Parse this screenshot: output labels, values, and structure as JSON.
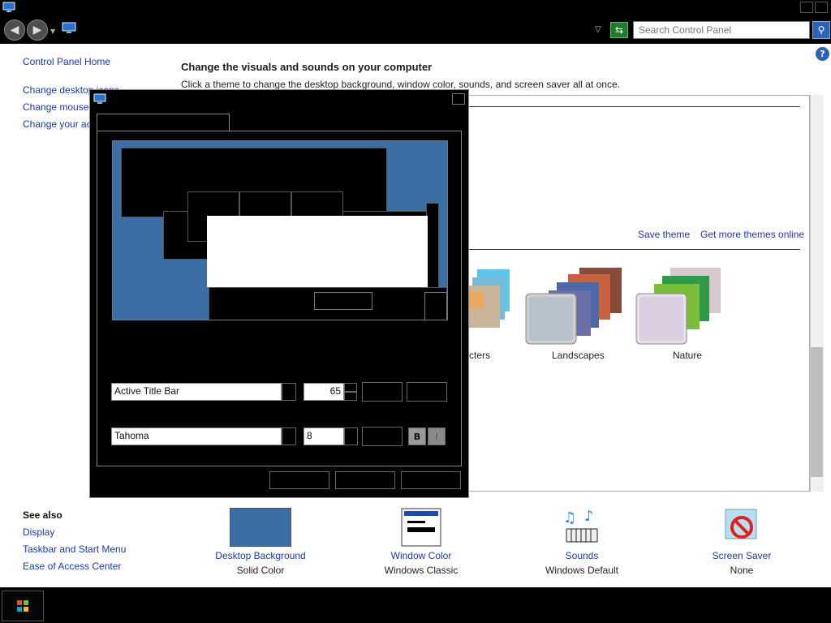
{
  "search": {
    "placeholder": "Search Control Panel"
  },
  "sidebar": {
    "home": "Control Panel Home",
    "links": [
      "Change desktop icons",
      "Change mouse pointers",
      "Change your account picture"
    ],
    "see_also_title": "See also",
    "see_also": [
      "Display",
      "Taskbar and Start Menu",
      "Ease of Access Center"
    ]
  },
  "main": {
    "heading": "Change the visuals and sounds on your computer",
    "subheading": "Click a theme to change the desktop background, window color, sounds, and screen saver all at once.",
    "save_theme": "Save theme",
    "get_more": "Get more themes online",
    "themes": [
      {
        "label": "Characters",
        "visible_label": "cters"
      },
      {
        "label": "Landscapes"
      },
      {
        "label": "Nature"
      }
    ]
  },
  "bottom": [
    {
      "label": "Desktop Background",
      "sub": "Solid Color",
      "icon": "desktop-background-icon"
    },
    {
      "label": "Window Color",
      "sub": "Windows Classic",
      "icon": "window-color-icon"
    },
    {
      "label": "Sounds",
      "sub": "Windows Default",
      "icon": "sounds-icon"
    },
    {
      "label": "Screen Saver",
      "sub": "None",
      "icon": "screen-saver-icon"
    }
  ],
  "dialog": {
    "item_value": "Active Title Bar",
    "size_value": "65",
    "font_value": "Tahoma",
    "font_size_value": "8",
    "bold_label": "B",
    "italic_label": "I"
  },
  "colors": {
    "link": "#1a3aa8",
    "desktop_blue": "#3a6ea5",
    "chrome": "#000000"
  }
}
